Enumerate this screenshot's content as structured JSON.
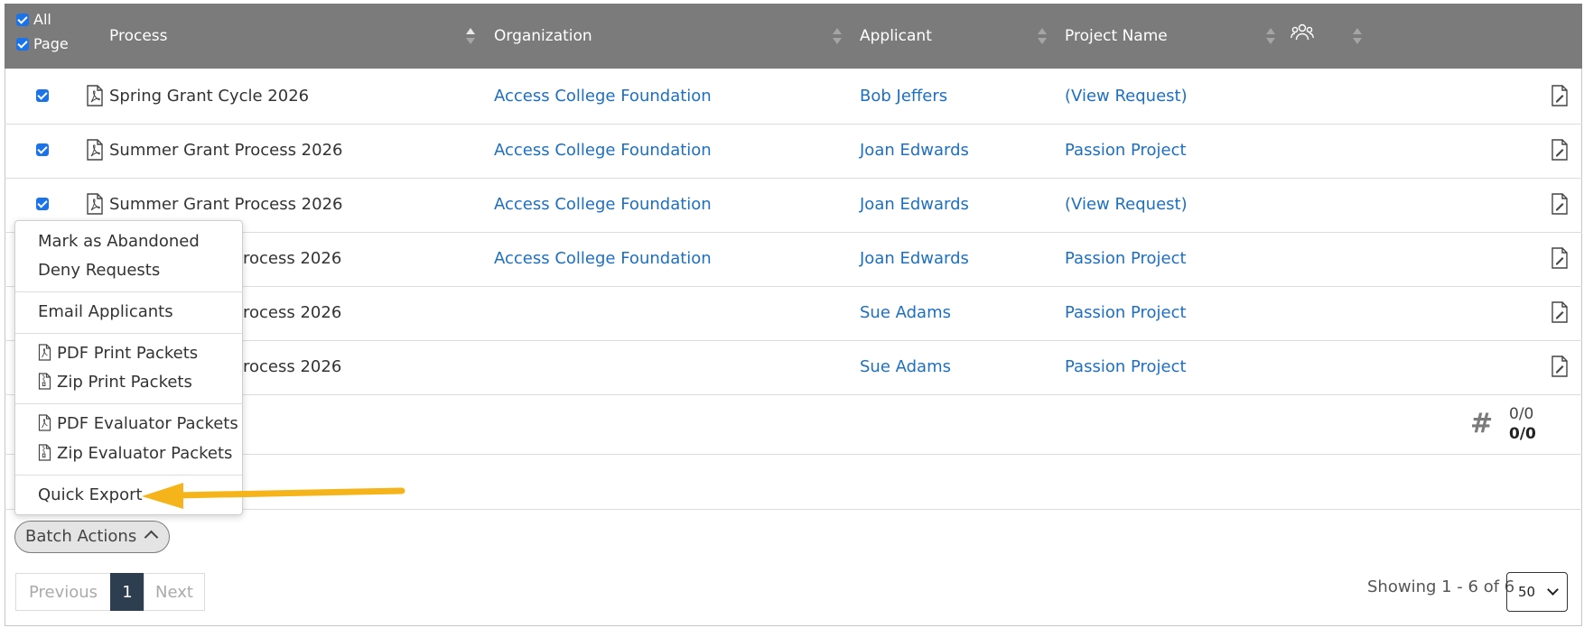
{
  "header": {
    "all_label": "All",
    "page_label": "Page",
    "col_process": "Process",
    "col_organization": "Organization",
    "col_applicant": "Applicant",
    "col_project": "Project Name"
  },
  "rows": [
    {
      "process": "Spring Grant Cycle 2026",
      "organization": "Access College Foundation",
      "applicant": "Bob Jeffers",
      "project": "(View Request)"
    },
    {
      "process": "Summer Grant Process 2026",
      "organization": "Access College Foundation",
      "applicant": "Joan Edwards",
      "project": "Passion Project"
    },
    {
      "process": "Summer Grant Process 2026",
      "organization": "Access College Foundation",
      "applicant": "Joan Edwards",
      "project": "(View Request)"
    },
    {
      "process": "rocess 2026",
      "organization": "Access College Foundation",
      "applicant": "Joan Edwards",
      "project": "Passion Project"
    },
    {
      "process": "rocess 2026",
      "organization": "",
      "applicant": "Sue Adams",
      "project": "Passion Project"
    },
    {
      "process": "rocess 2026",
      "organization": "",
      "applicant": "Sue Adams",
      "project": "Passion Project"
    }
  ],
  "footer": {
    "count_top": "0/0",
    "count_bottom": "0/0"
  },
  "menu": {
    "mark_abandoned": "Mark as Abandoned",
    "deny_requests": "Deny Requests",
    "email_applicants": "Email Applicants",
    "pdf_print": "PDF Print Packets",
    "zip_print": "Zip Print Packets",
    "pdf_evaluator": "PDF Evaluator Packets",
    "zip_evaluator": "Zip Evaluator Packets",
    "quick_export": "Quick Export"
  },
  "batch_actions_label": "Batch Actions",
  "pagination": {
    "previous": "Previous",
    "page": "1",
    "next": "Next",
    "showing": "Showing 1 - 6 of 6",
    "page_size": "50"
  },
  "colors": {
    "header_bg": "#7b7b7b",
    "link": "#1d6fc1",
    "checkbox": "#1a73e8",
    "annotation_arrow": "#f4b41a",
    "active_page": "#2d3e50"
  }
}
